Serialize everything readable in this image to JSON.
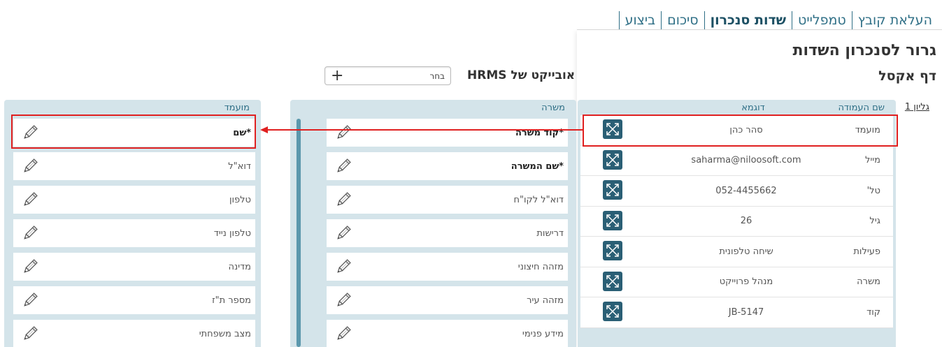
{
  "tabs": [
    {
      "label": "העלאת קובץ",
      "active": false
    },
    {
      "label": "טמפלייט",
      "active": false
    },
    {
      "label": "שדות סנכרון",
      "active": true
    },
    {
      "label": "סיכום",
      "active": false
    },
    {
      "label": "ביצוע",
      "active": false
    }
  ],
  "page": {
    "title": "גרור לסנכרון השדות",
    "sheet_title": "דף אקסל",
    "sheet_link": "גליון 1"
  },
  "excel": {
    "col_name_header": "שם העמודה",
    "col_example_header": "דוגמא",
    "rows": [
      {
        "name": "מועמד",
        "example": "סהר כהן"
      },
      {
        "name": "מייל",
        "example": "saharma@niloosoft.com"
      },
      {
        "name": "טל'",
        "example": "052-4455662"
      },
      {
        "name": "גיל",
        "example": "26"
      },
      {
        "name": "פעילות",
        "example": "שיחה טלפונית"
      },
      {
        "name": "משרה",
        "example": "מנהל פרוייקט"
      },
      {
        "name": "קוד",
        "example": "JB-5147"
      }
    ]
  },
  "hrms": {
    "label": "אובייקט של HRMS",
    "select_value": "בחר",
    "add_symbol": "+"
  },
  "position_panel": {
    "header": "משרה",
    "fields": [
      {
        "label": "*קוד משרה",
        "bold": true
      },
      {
        "label": "*שם המשרה",
        "bold": true
      },
      {
        "label": "דוא\"ל לקו\"ח",
        "bold": false
      },
      {
        "label": "דרישות",
        "bold": false
      },
      {
        "label": "מזהה חיצוני",
        "bold": false
      },
      {
        "label": "מזהה עיר",
        "bold": false
      },
      {
        "label": "מידע פנימי",
        "bold": false
      }
    ]
  },
  "candidate_panel": {
    "header": "מועמד",
    "fields": [
      {
        "label": "*שם",
        "bold": true
      },
      {
        "label": "דוא\"ל",
        "bold": false
      },
      {
        "label": "טלפון",
        "bold": false
      },
      {
        "label": "טלפון נייד",
        "bold": false
      },
      {
        "label": "מדינה",
        "bold": false
      },
      {
        "label": "מספר ת\"ז",
        "bold": false
      },
      {
        "label": "מצב משפחתי",
        "bold": false
      }
    ]
  },
  "colors": {
    "accent": "#2f6f86",
    "panel_bg": "#d4e4ea",
    "drag_button": "#2a5f75",
    "highlight": "#e02020"
  },
  "icons": {
    "drag": "expand-arrows-icon",
    "edit": "pencil-icon"
  }
}
